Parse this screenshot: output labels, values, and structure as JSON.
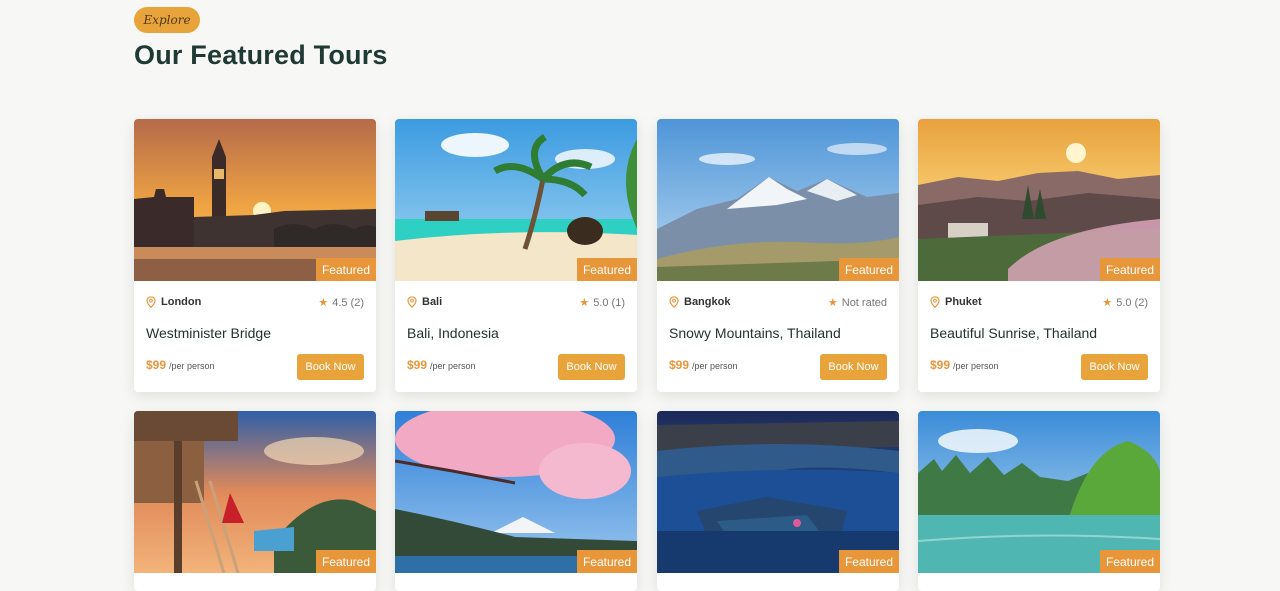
{
  "header": {
    "tag": "Explore",
    "title": "Our Featured Tours"
  },
  "tours": [
    {
      "location": "London",
      "rating": "4.5 (2)",
      "name": "Westminister Bridge",
      "price": "$99",
      "per": "/per person",
      "badge": "Featured",
      "book": "Book Now"
    },
    {
      "location": "Bali",
      "rating": "5.0 (1)",
      "name": "Bali, Indonesia",
      "price": "$99",
      "per": "/per person",
      "badge": "Featured",
      "book": "Book Now"
    },
    {
      "location": "Bangkok",
      "rating": "Not rated",
      "name": "Snowy Mountains, Thailand",
      "price": "$99",
      "per": "/per person",
      "badge": "Featured",
      "book": "Book Now"
    },
    {
      "location": "Phuket",
      "rating": "5.0 (2)",
      "name": "Beautiful Sunrise, Thailand",
      "price": "$99",
      "per": "/per person",
      "badge": "Featured",
      "book": "Book Now"
    },
    {
      "badge": "Featured"
    },
    {
      "badge": "Featured"
    },
    {
      "badge": "Featured"
    },
    {
      "badge": "Featured"
    }
  ],
  "colors": {
    "accent": "#e8963a",
    "button": "#e8a43b",
    "title": "#1f3a34",
    "background": "#f7f8f6"
  }
}
